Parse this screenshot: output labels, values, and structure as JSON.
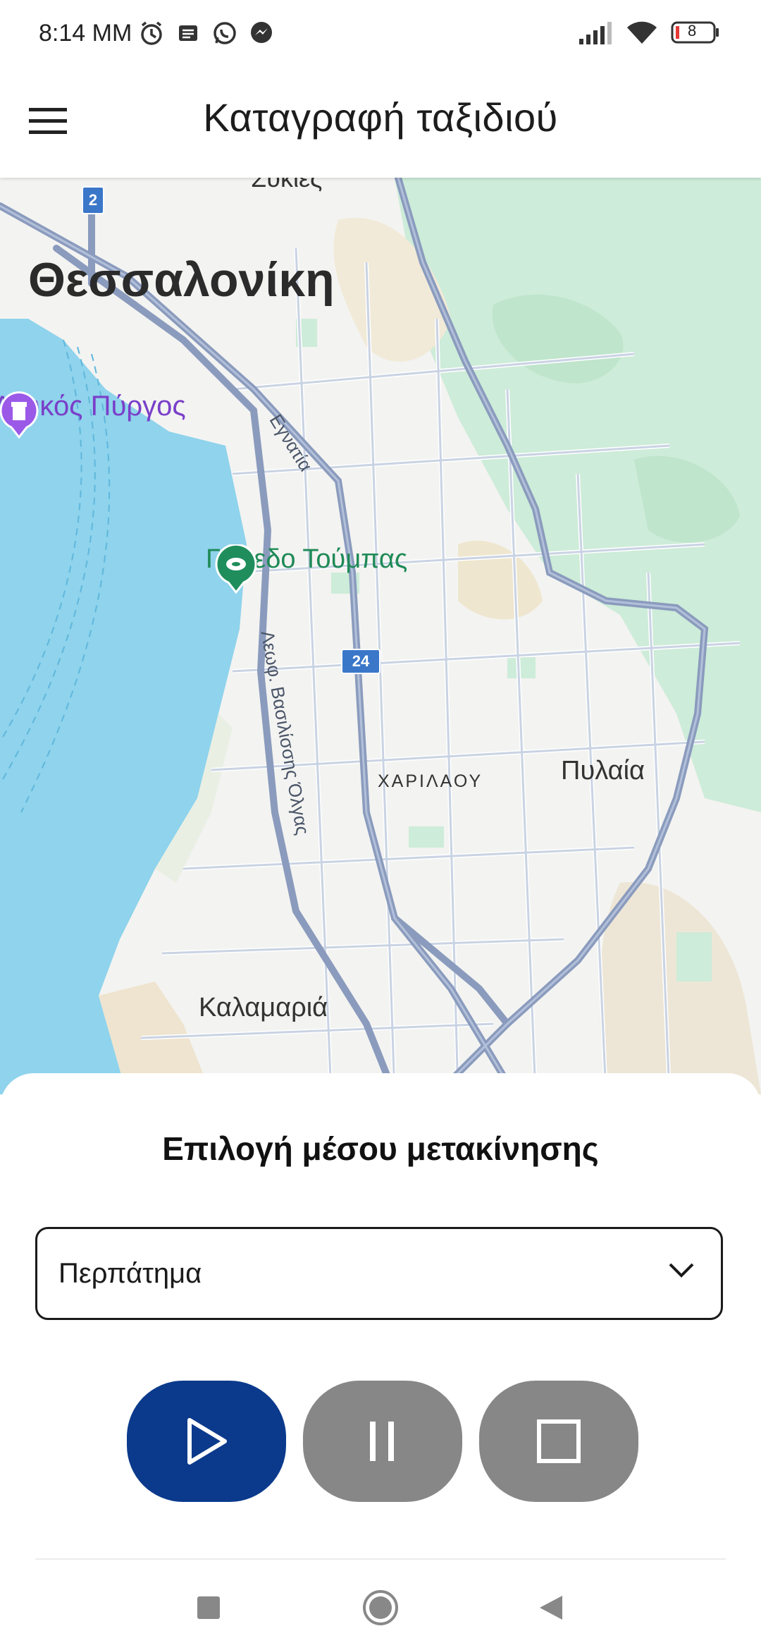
{
  "status_bar": {
    "time": "8:14 MM",
    "battery": "8",
    "icons_left": [
      "alarm-icon",
      "message-icon",
      "whatsapp-icon",
      "messenger-icon"
    ],
    "icons_right": [
      "signal-icon",
      "wifi-icon",
      "battery-icon"
    ]
  },
  "app_bar": {
    "title": "Καταγραφή ταξιδιού",
    "menu_icon": "hamburger-menu-icon"
  },
  "map": {
    "labels": {
      "city": "Θεσσαλονίκη",
      "poi_tower": "Λευκός Πύργος",
      "poi_stadium": "Γήπεδο Τούμπας",
      "district_pylaia": "Πυλαία",
      "district_kalamaria": "Καλαμαριά",
      "district_charilaou": "ΧΑΡΙΛΑΟΥ",
      "top_cut": "Συκιές",
      "road_egnatia": "Εγνατία",
      "road_vas_olgas": "Λεωφ. Βασιλίσσης Όλγας"
    },
    "shields": {
      "route_2": "2",
      "route_24": "24"
    },
    "colors": {
      "sea": "#8fd3ec",
      "land": "#f3f3f1",
      "park": "#cdecd9",
      "road_major": "#8a9bbd",
      "road_minor": "#ffffff",
      "shield": "#3a77c9"
    }
  },
  "sheet": {
    "title": "Επιλογή μέσου μετακίνησης",
    "mode_select": {
      "value": "Περπάτημα",
      "icon": "chevron-down-icon"
    },
    "controls": {
      "play_icon": "play-icon",
      "pause_icon": "pause-icon",
      "stop_icon": "stop-icon",
      "play_color": "#0b3a8c",
      "disabled_color": "#878787"
    }
  },
  "nav_bar": {
    "icons": [
      "recents-square-icon",
      "home-circle-icon",
      "back-triangle-icon"
    ]
  }
}
